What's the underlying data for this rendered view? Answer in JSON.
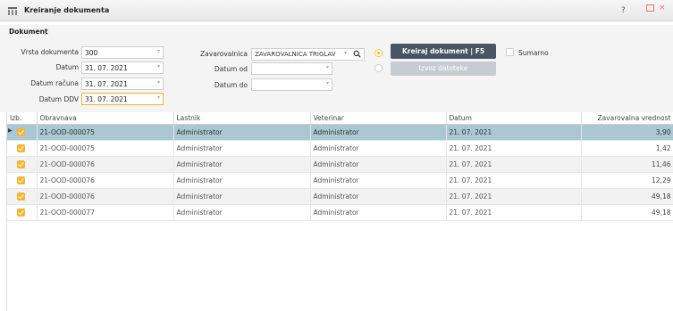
{
  "window": {
    "title": "Kreiranje dokumenta",
    "help": "?",
    "close": "×"
  },
  "form": {
    "section_title": "Dokument",
    "vrsta_label": "Vrsta dokumenta",
    "vrsta_value": "300",
    "datum_label": "Datum",
    "datum_value": "31. 07. 2021",
    "datum_racuna_label": "Datum računa",
    "datum_racuna_value": "31. 07. 2021",
    "datum_ddv_label": "Datum DDV",
    "datum_ddv_value": "31. 07. 2021",
    "zavarovalnica_label": "Zavarovalnica",
    "zavarovalnica_value": "ZAVAROVALNICA TRIGLAV",
    "datum_od_label": "Datum od",
    "datum_od_value": "",
    "datum_do_label": "Datum do",
    "datum_do_value": "",
    "create_button": "Kreiraj dokument | F5",
    "export_button": "Izvoz datoteke",
    "sumarno_label": "Sumarno"
  },
  "table": {
    "columns": [
      "Izb.",
      "Obravnava",
      "Lastnik",
      "Veterinar",
      "Datum",
      "Zavarovalna vrednost"
    ],
    "rows": [
      {
        "obravnava": "21-OOD-000075",
        "lastnik": "Administrator",
        "veterinar": "Administrator",
        "datum": "21. 07. 2021",
        "vrednost": "3,90"
      },
      {
        "obravnava": "21-OOD-000075",
        "lastnik": "Administrator",
        "veterinar": "Administrator",
        "datum": "21. 07. 2021",
        "vrednost": "1,42"
      },
      {
        "obravnava": "21-OOD-000076",
        "lastnik": "Administrator",
        "veterinar": "Administrator",
        "datum": "21. 07. 2021",
        "vrednost": "11,46"
      },
      {
        "obravnava": "21-OOD-000076",
        "lastnik": "Administrator",
        "veterinar": "Administrator",
        "datum": "21. 07. 2021",
        "vrednost": "12,29"
      },
      {
        "obravnava": "21-OOD-000076",
        "lastnik": "Administrator",
        "veterinar": "Administrator",
        "datum": "21. 07. 2021",
        "vrednost": "49,18"
      },
      {
        "obravnava": "21-OOD-000077",
        "lastnik": "Administrator",
        "veterinar": "Administrator",
        "datum": "21. 07. 2021",
        "vrednost": "49,18"
      }
    ]
  },
  "colors": {
    "accent": "#f4b533",
    "selected_row": "#a9c8d4",
    "button_dark": "#4a5564"
  }
}
